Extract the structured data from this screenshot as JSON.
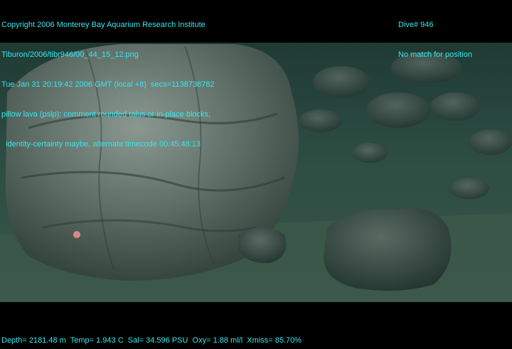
{
  "overlay": {
    "top_left": [
      "Copyright 2006 Monterey Bay Aquarium Research Institute",
      "Tiburon/2006/tibr946/00_44_15_12.png",
      "Tue Jan 31 20:19:42 2006 GMT (local +8)  secs=1138738782",
      "pillow lava (pslp): comment rounded talus or in-place blocks,",
      "  identity-certainty maybe, alternate timecode 00:45:48:13"
    ],
    "top_right": [
      "Dive# 946",
      "No match for position"
    ],
    "bottom": "Depth= 2181.48 m  Temp= 1.943 C  Sal= 34.596 PSU  Oxy= 1.88 ml/l  Xmiss= 85.70%"
  },
  "colors": {
    "overlay_text": "#35e8f0",
    "water": "#2a4a40",
    "rock": "#5e6e66",
    "letterbox": "#000000"
  }
}
